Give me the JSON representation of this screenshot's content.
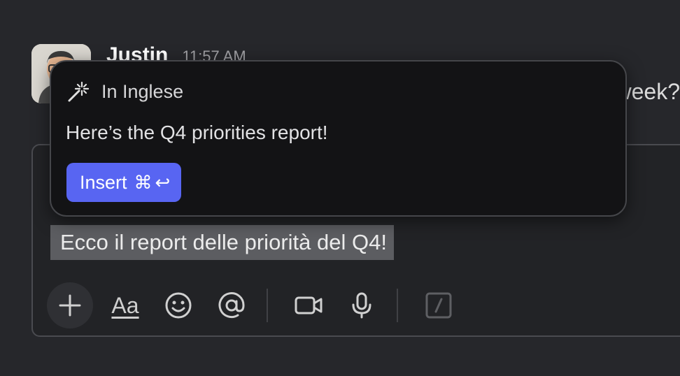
{
  "message": {
    "author": "Justin",
    "time": "11:57 AM",
    "body_fragment": "week?"
  },
  "popover": {
    "title": "In Inglese",
    "translation": "Here’s the Q4 priorities report!",
    "insert_label": "Insert",
    "shortcut_cmd": "⌘",
    "shortcut_enter": "↩"
  },
  "composer": {
    "text": "Ecco il report delle priorità del Q4!",
    "format_label": "Aa"
  },
  "icons": [
    "magic-wand-icon",
    "plus-icon",
    "emoji-icon",
    "mention-icon",
    "video-icon",
    "microphone-icon",
    "slash-command-icon"
  ],
  "colors": {
    "background": "#26272b",
    "popover_bg": "#131315",
    "accent": "#5865f2",
    "selection": "#5c5d61"
  }
}
